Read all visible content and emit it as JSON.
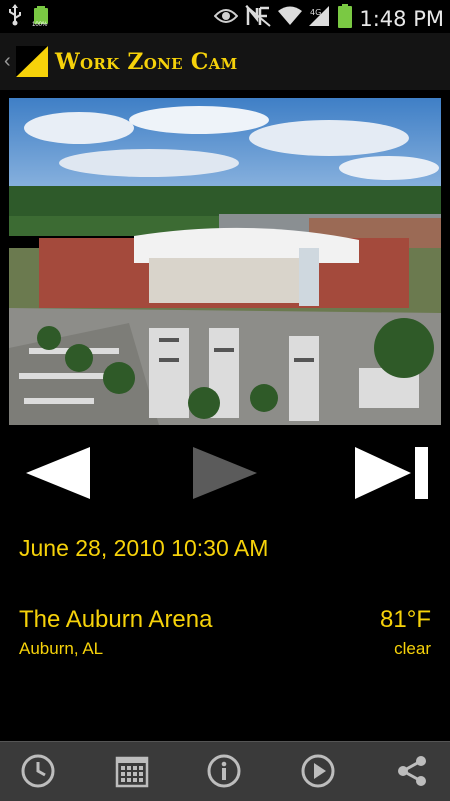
{
  "status_bar": {
    "battery_small_label": "100%",
    "time": "1:48 PM"
  },
  "app_bar": {
    "title": "Work Zone Cam"
  },
  "camera": {
    "image_description_icon": "camera-snapshot"
  },
  "controls": {
    "previous_icon": "triangle-left-icon",
    "play_icon": "triangle-right-icon",
    "last_icon": "skip-to-end-icon"
  },
  "info": {
    "datetime": "June 28, 2010 10:30 AM",
    "location_name": "The Auburn Arena",
    "location_city": "Auburn, AL",
    "temperature": "81°F",
    "condition": "clear"
  },
  "bottom_bar": {
    "icons": [
      "clock-icon",
      "calendar-icon",
      "info-icon",
      "play-circle-icon",
      "share-icon"
    ]
  },
  "colors": {
    "accent": "#f6d20a",
    "background": "#000000",
    "app_bar": "#141414",
    "bottom_bar": "#3a3a3a"
  }
}
